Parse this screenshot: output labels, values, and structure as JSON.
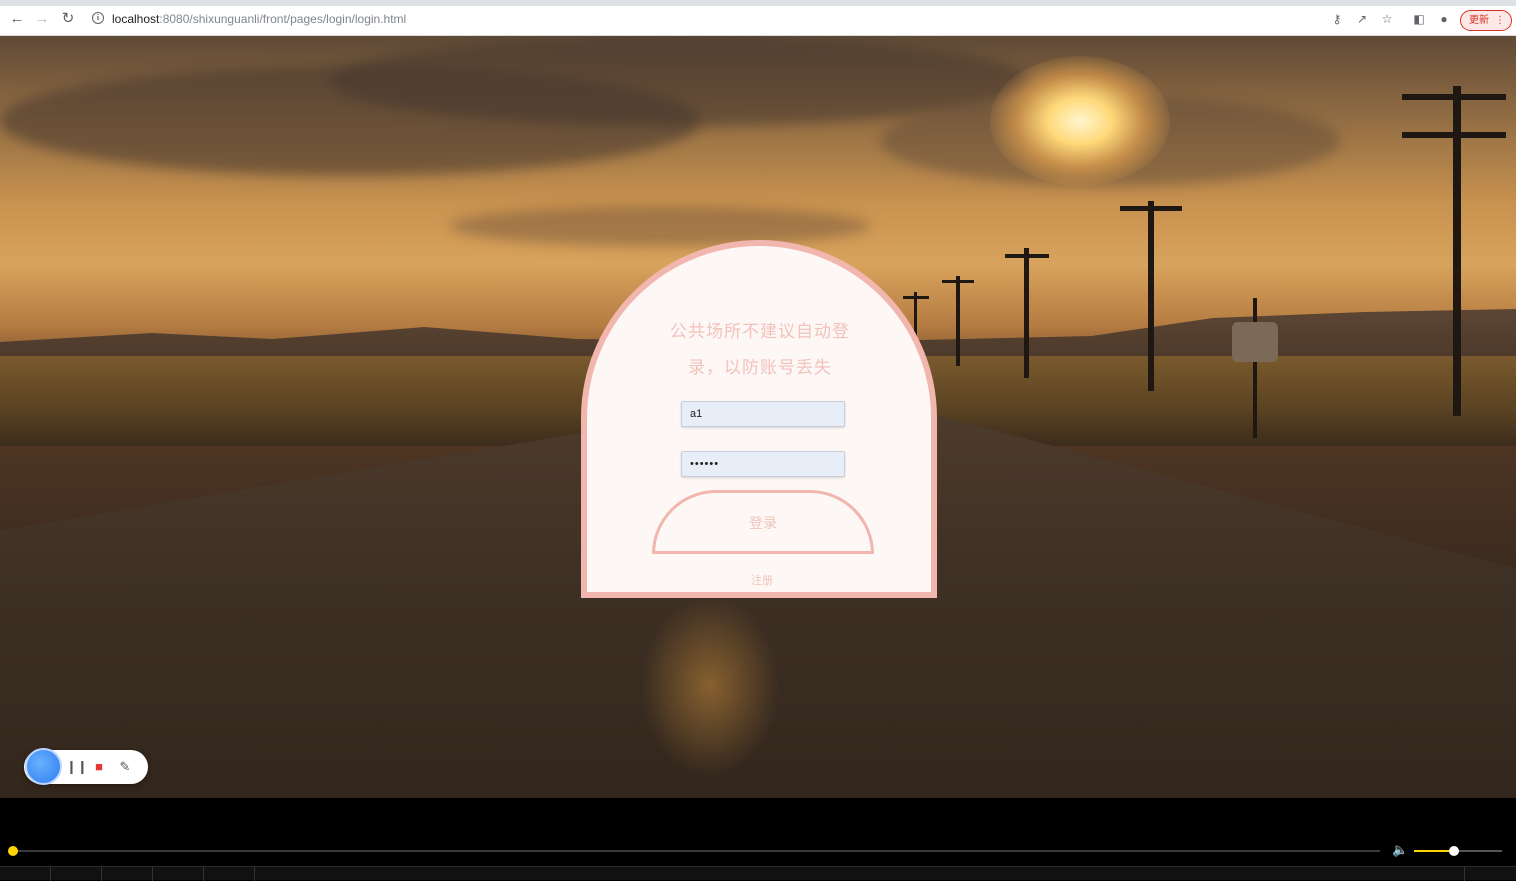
{
  "browser": {
    "url_host": "localhost",
    "url_rest": ":8080/shixunguanli/front/pages/login/login.html",
    "update_label": "更新",
    "icons": [
      "back-icon",
      "forward-icon",
      "reload-icon",
      "info-icon",
      "key-icon",
      "share-icon",
      "star-icon",
      "sidepanel-icon",
      "profile-icon",
      "menu-icon"
    ]
  },
  "login": {
    "title_line1": "公共场所不建议自动登",
    "title_line2": "录，以防账号丢失",
    "username_value": "a1",
    "password_value": "••••••",
    "login_label": "登录",
    "register_label": "注册"
  },
  "recorder": {
    "icons": [
      "record-dot-icon",
      "pause-icon",
      "folder-icon",
      "pen-icon"
    ]
  },
  "player": {
    "progress": 0.0,
    "volume": 0.45,
    "accent_color": "#ffd400"
  },
  "colors": {
    "card_border": "#f1b6ad",
    "card_background": "#fdf7f6",
    "card_text": "#f2c2bb"
  }
}
